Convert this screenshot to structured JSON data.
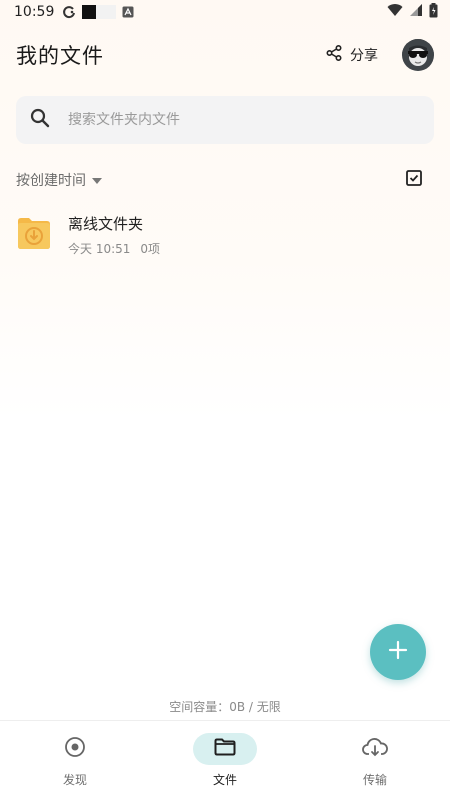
{
  "status_bar": {
    "time": "10:59",
    "icons": [
      "sync-icon",
      "app-notification-icon",
      "autofill-icon",
      "wifi-icon",
      "signal-icon",
      "battery-icon"
    ]
  },
  "header": {
    "title": "我的文件",
    "share_label": "分享",
    "share_icon": "share-icon",
    "avatar_icon": "avatar-sunglasses-icon"
  },
  "search": {
    "placeholder": "搜索文件夹内文件",
    "icon": "search-icon"
  },
  "sort": {
    "label": "按创建时间",
    "icon": "caret-down-icon",
    "select_icon": "checkbox-icon"
  },
  "files": [
    {
      "name": "离线文件夹",
      "date": "今天 10:51",
      "count": "0项",
      "icon": "offline-folder-icon"
    }
  ],
  "fab": {
    "icon": "plus-icon"
  },
  "storage": {
    "text": "空间容量：0B / 无限"
  },
  "bottom_nav": {
    "items": [
      {
        "label": "发现",
        "icon": "discover-icon",
        "active": false
      },
      {
        "label": "文件",
        "icon": "folder-icon",
        "active": true
      },
      {
        "label": "传输",
        "icon": "cloud-download-icon",
        "active": false
      }
    ]
  },
  "colors": {
    "accent": "#5bbfc1",
    "active_nav_bg": "#d8f0f0",
    "folder": "#f7c85e",
    "background_top": "#fff9f3"
  }
}
